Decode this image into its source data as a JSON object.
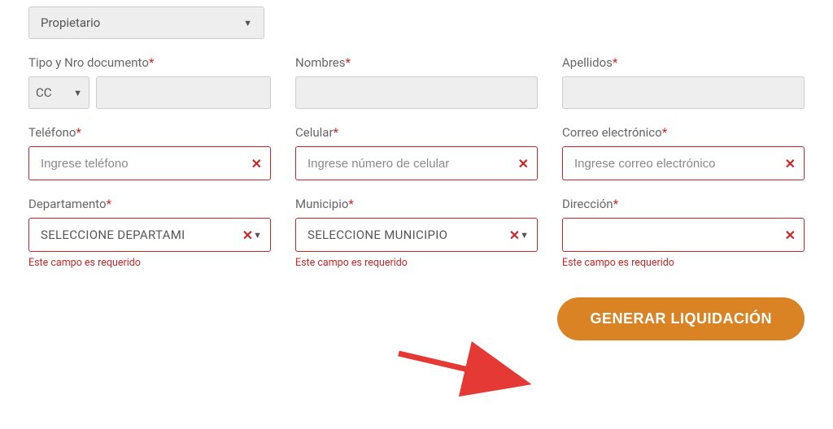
{
  "topSelect": {
    "value": "Propietario"
  },
  "labels": {
    "docType": "Tipo y Nro documento",
    "nombres": "Nombres",
    "apellidos": "Apellidos",
    "telefono": "Teléfono",
    "celular": "Celular",
    "correo": "Correo electrónico",
    "departamento": "Departamento",
    "municipio": "Municipio",
    "direccion": "Dirección"
  },
  "fields": {
    "docTypeValue": "CC",
    "telefonoPlaceholder": "Ingrese teléfono",
    "celularPlaceholder": "Ingrese número de celular",
    "correoPlaceholder": "Ingrese correo electrónico",
    "departamentoValue": "SELECCIONE DEPARTAMI",
    "municipioValue": "SELECCIONE MUNICIPIO"
  },
  "errors": {
    "required": "Este campo es requerido"
  },
  "button": {
    "generate": "GENERAR LIQUIDACIÓN"
  }
}
